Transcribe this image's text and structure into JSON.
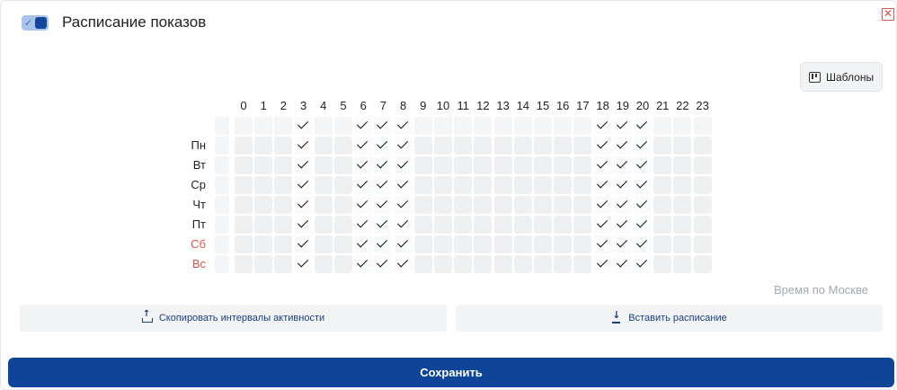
{
  "header": {
    "title": "Расписание показов",
    "toggle_checked": true,
    "close_icon": "close-x-icon"
  },
  "templates_button": {
    "label": "Шаблоны",
    "icon": "templates-icon"
  },
  "grid": {
    "hours": [
      "0",
      "1",
      "2",
      "3",
      "4",
      "5",
      "6",
      "7",
      "8",
      "9",
      "10",
      "11",
      "12",
      "13",
      "14",
      "15",
      "16",
      "17",
      "18",
      "19",
      "20",
      "21",
      "22",
      "23"
    ],
    "days": [
      {
        "label": "Пн",
        "weekend": false
      },
      {
        "label": "Вт",
        "weekend": false
      },
      {
        "label": "Ср",
        "weekend": false
      },
      {
        "label": "Чт",
        "weekend": false
      },
      {
        "label": "Пт",
        "weekend": false
      },
      {
        "label": "Сб",
        "weekend": true
      },
      {
        "label": "Вс",
        "weekend": true
      }
    ],
    "active_hours": [
      3,
      6,
      7,
      8,
      18,
      19,
      20
    ],
    "weekend_color": "#d9534f",
    "check_color": "#111111"
  },
  "timezone_note": "Время по Москве",
  "actions": {
    "copy_label": "Скопировать интервалы активности",
    "paste_label": "Вставить расписание"
  },
  "save_label": "Сохранить",
  "colors": {
    "primary": "#0f4598",
    "cell_bg": "#eef0f2"
  }
}
